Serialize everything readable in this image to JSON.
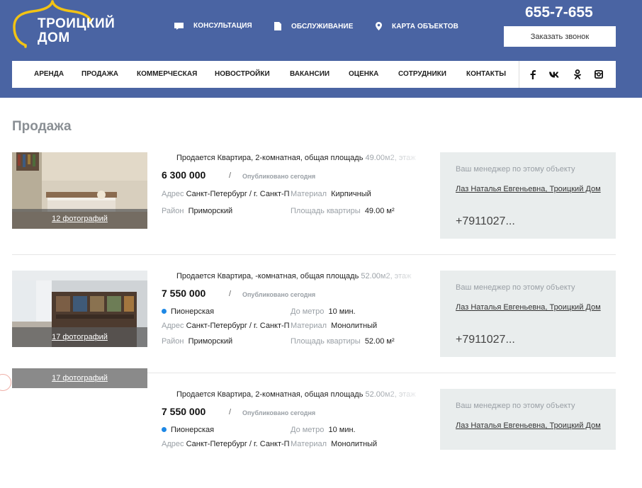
{
  "brand": {
    "logo_line1": "ТРОИЦКИЙ",
    "logo_line2": "ДОМ",
    "accent": "#f2c314",
    "header_bg": "#4a64a3"
  },
  "header": {
    "phone": "655-7-655",
    "call_button": "Заказать звонок",
    "top_links": [
      {
        "label": "КОНСУЛЬТАЦИЯ",
        "icon": "chat-icon"
      },
      {
        "label": "ОБСЛУЖИВАНИЕ",
        "icon": "document-icon"
      },
      {
        "label": "КАРТА ОБЪЕКТОВ",
        "icon": "map-pin-icon"
      }
    ],
    "main_nav": [
      "АРЕНДА",
      "ПРОДАЖА",
      "КОММЕРЧЕСКАЯ",
      "НОВОСТРОЙКИ",
      "ВАКАНСИИ",
      "ОЦЕНКА",
      "СОТРУДНИКИ",
      "КОНТАКТЫ"
    ],
    "social": [
      "facebook-icon",
      "vk-icon",
      "odnoklassniki-icon",
      "instagram-icon"
    ],
    "social_glyphs": [
      "f",
      "вк",
      "ок",
      "ig"
    ]
  },
  "page": {
    "title": "Продажа"
  },
  "listings": [
    {
      "photo_caption": "12 фотографий",
      "title_main": "Продается Квартира, 2-комнатная, общая площадь",
      "title_tail": " 49.00м2, этаж",
      "price": "6 300 000",
      "slash": "/",
      "published": "Опубликовано сегодня",
      "address_key": "Адрес",
      "address_val": "Санкт-Петербург / г. Санкт-Петербург",
      "material_key": "Материал",
      "material_val": "Кирпичный",
      "district_key": "Район",
      "district_val": "Приморский",
      "area_key": "Площадь квартиры",
      "area_val": "49.00 м²",
      "manager_label": "Ваш менеджер по этому объекту",
      "manager_name": "Лаз Наталья Евгеньевна, Троицкий Дом",
      "manager_phone": "+7911027..."
    },
    {
      "photo_caption": "17 фотографий",
      "title_main": "Продается Квартира, -комнатная, общая площадь",
      "title_tail": " 52.00м2, этаж",
      "price": "7 550 000",
      "slash": "/",
      "published": "Опубликовано сегодня",
      "metro": "Пионерская",
      "metro_time_key": "До метро",
      "metro_time_val": "10 мин.",
      "address_key": "Адрес",
      "address_val": "Санкт-Петербург / г. Санкт-Петербург",
      "material_key": "Материал",
      "material_val": "Монолитный",
      "district_key": "Район",
      "district_val": "Приморский",
      "area_key": "Площадь квартиры",
      "area_val": "52.00 м²",
      "manager_label": "Ваш менеджер по этому объекту",
      "manager_name": "Лаз Наталья Евгеньевна, Троицкий Дом",
      "manager_phone": "+7911027..."
    },
    {
      "photo_caption": "17 фотографий",
      "title_main": "Продается Квартира, 2-комнатная, общая площадь",
      "title_tail": " 52.00м2, этаж",
      "price": "7 550 000",
      "slash": "/",
      "published": "Опубликовано сегодня",
      "metro": "Пионерская",
      "metro_time_key": "До метро",
      "metro_time_val": "10 мин.",
      "address_key": "Адрес",
      "address_val": "Санкт-Петербург / г. Санкт-Петербург",
      "material_key": "Материал",
      "material_val": "Монолитный",
      "manager_label": "Ваш менеджер по этому объекту",
      "manager_name": "Лаз Наталья Евгеньевна, Троицкий Дом"
    }
  ]
}
